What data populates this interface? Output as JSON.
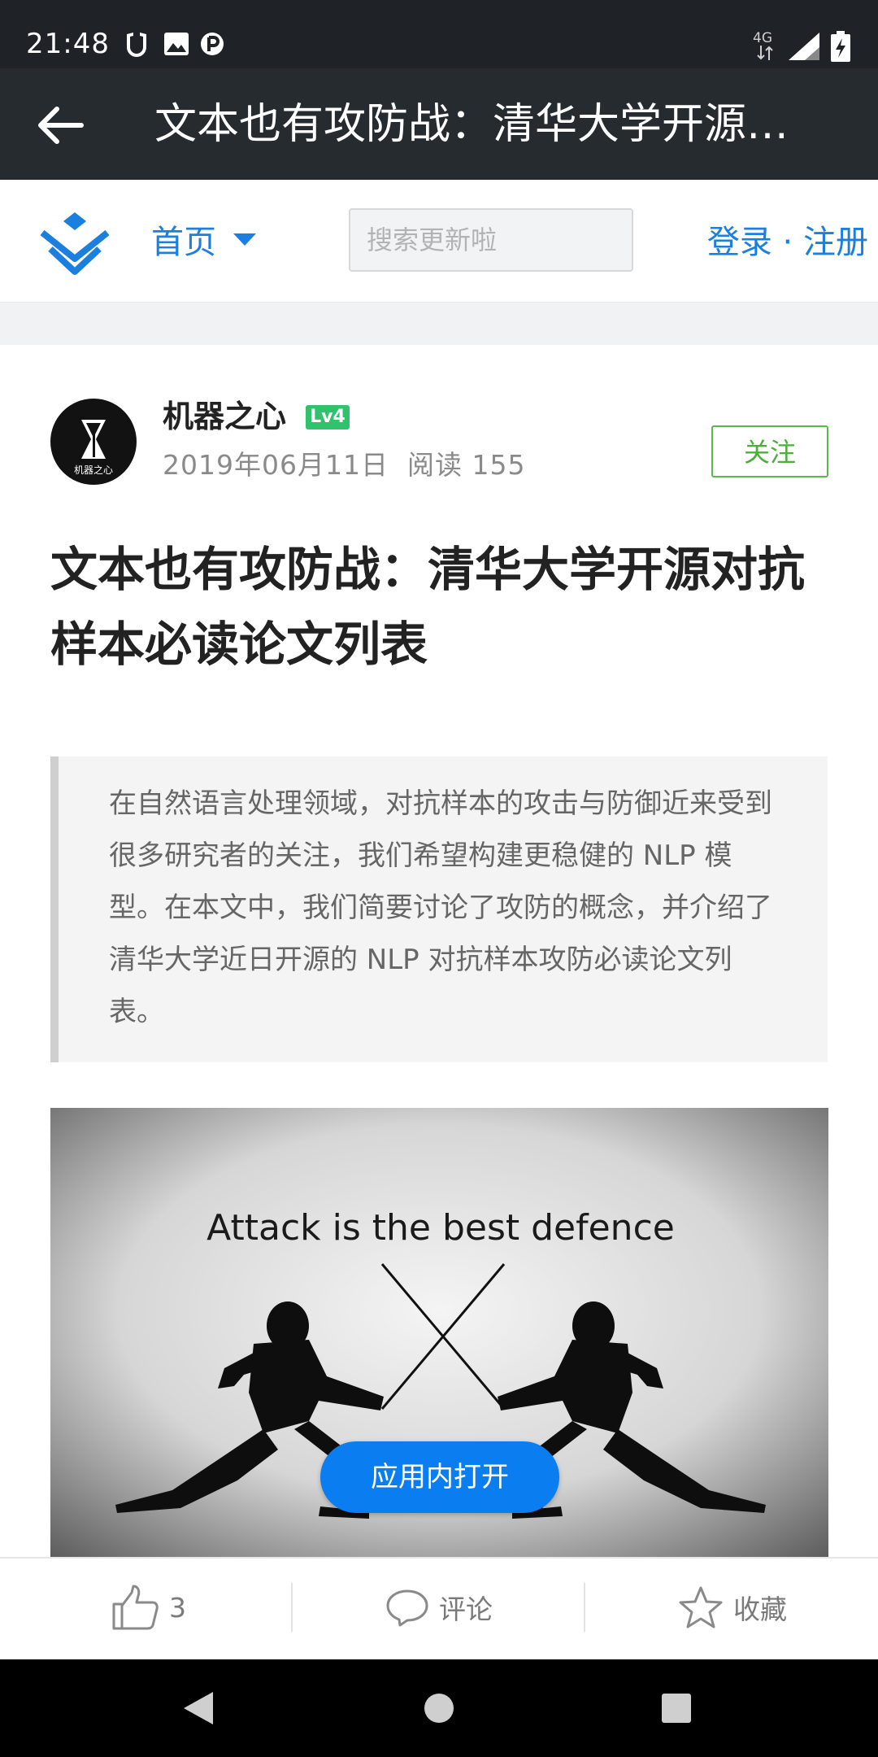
{
  "status_bar": {
    "time": "21:48",
    "network": "4G"
  },
  "title_bar": {
    "title": "文本也有攻防战：清华大学开源对抗样本必读论文列表"
  },
  "site_header": {
    "home_label": "首页",
    "search_placeholder": "搜索更新啦",
    "login_label": "登录",
    "separator": " · ",
    "register_label": "注册"
  },
  "author": {
    "name": "机器之心",
    "level": "Lv4",
    "avatar_text": "机器之心",
    "date": "2019年06月11日",
    "reads_label": "阅读",
    "reads": "155",
    "follow_label": "关注"
  },
  "article": {
    "title": "文本也有攻防战：清华大学开源对抗样本必读论文列表",
    "summary": "在自然语言处理领域，对抗样本的攻击与防御近来受到很多研究者的关注，我们希望构建更稳健的 NLP 模型。在本文中，我们简要讨论了攻防的概念，并介绍了清华大学近日开源的 NLP 对抗样本攻防必读论文列表。",
    "image_caption": "Attack is the best defence",
    "open_in_app_label": "应用内打开"
  },
  "actions": {
    "like_count": "3",
    "comment_label": "评论",
    "favorite_label": "收藏"
  },
  "colors": {
    "accent": "#1b7fe0",
    "follow_green": "#4caf3a",
    "dark_bar": "#262b30",
    "button_blue": "#0a7df0"
  }
}
